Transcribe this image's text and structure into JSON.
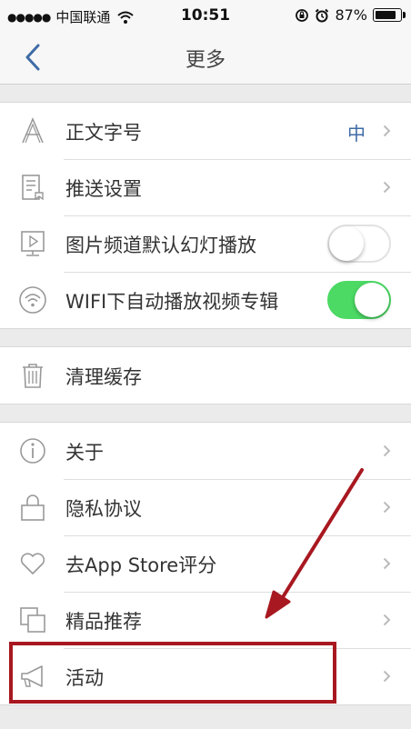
{
  "status_bar": {
    "signal_dots": "●●●●●",
    "carrier": "中国联通",
    "time": "10:51",
    "battery_text": "87%",
    "battery_level": 0.87
  },
  "nav": {
    "title": "更多"
  },
  "sections": {
    "display": [
      {
        "label": "正文字号",
        "value": "中",
        "icon": "font-size-icon"
      },
      {
        "label": "推送设置",
        "icon": "push-settings-icon"
      },
      {
        "label": "图片频道默认幻灯播放",
        "icon": "slideshow-icon",
        "toggle": false
      },
      {
        "label": "WIFI下自动播放视频专辑",
        "icon": "wifi-icon",
        "toggle": true
      }
    ],
    "storage": [
      {
        "label": "清理缓存",
        "icon": "trash-icon"
      }
    ],
    "misc": [
      {
        "label": "关于",
        "icon": "info-icon"
      },
      {
        "label": "隐私协议",
        "icon": "lock-icon"
      },
      {
        "label": "去App Store评分",
        "icon": "heart-icon"
      },
      {
        "label": "精品推荐",
        "icon": "stacked-squares-icon"
      },
      {
        "label": "活动",
        "icon": "megaphone-icon"
      }
    ]
  },
  "colors": {
    "accent_blue": "#3e6ba6",
    "toggle_on": "#4cd964",
    "annotation_red": "#a81820"
  }
}
